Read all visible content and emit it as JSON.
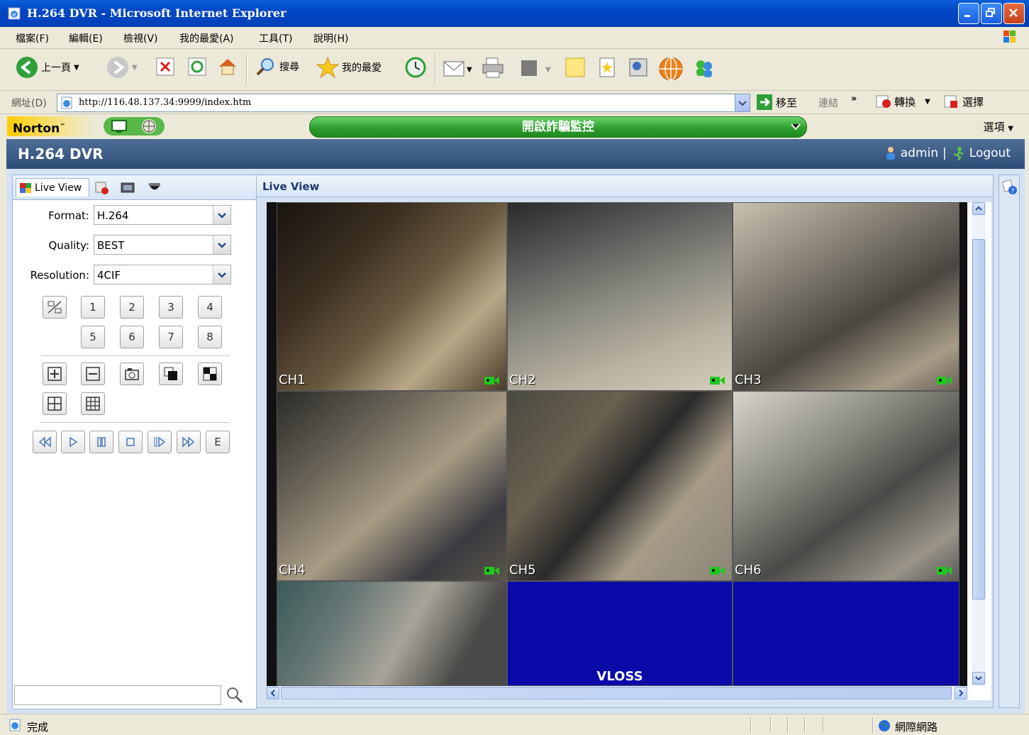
{
  "window": {
    "title": "H.264 DVR - Microsoft Internet Explorer"
  },
  "menu": [
    "檔案(F)",
    "編輯(E)",
    "檢視(V)",
    "我的最愛(A)",
    "工具(T)",
    "說明(H)"
  ],
  "toolbar": {
    "back_label": "上一頁",
    "search_label": "搜尋",
    "favorites_label": "我的最愛"
  },
  "address": {
    "label": "網址(D)",
    "url": "http://116.48.137.34:9999/index.htm",
    "go_label": "移至",
    "links_label": "連結",
    "convert_label": "轉換",
    "select_label": "選擇"
  },
  "norton": {
    "logo": "Norton",
    "bar_text": "開啟詐騙監控",
    "options_label": "選項"
  },
  "app": {
    "title": "H.264 DVR",
    "user": "admin",
    "separator": "|",
    "logout": "Logout"
  },
  "left": {
    "tab_live": "Live View",
    "format_label": "Format:",
    "format_value": "H.264",
    "quality_label": "Quality:",
    "quality_value": "BEST",
    "resolution_label": "Resolution:",
    "resolution_value": "4CIF",
    "channels_row1": [
      "1",
      "2",
      "3",
      "4"
    ],
    "channels_row2": [
      "5",
      "6",
      "7",
      "8"
    ],
    "playback_e": "E"
  },
  "main": {
    "title": "Live View",
    "cams": [
      {
        "label": "CH1",
        "rec": true
      },
      {
        "label": "CH2",
        "rec": true
      },
      {
        "label": "CH3",
        "rec": true
      },
      {
        "label": "CH4",
        "rec": true
      },
      {
        "label": "CH5",
        "rec": true
      },
      {
        "label": "CH6",
        "rec": true
      },
      {
        "label": "",
        "rec": false
      },
      {
        "label": "",
        "rec": false
      },
      {
        "label": "",
        "rec": false
      }
    ],
    "vloss_text": "VLOSS"
  },
  "status": {
    "text": "完成",
    "zone": "網際網路"
  },
  "colors": {
    "titlebar": "#0346c4",
    "app_header": "#2d4d78",
    "vloss_bg": "#0a0aa8",
    "norton_green": "#2e9e2e"
  }
}
